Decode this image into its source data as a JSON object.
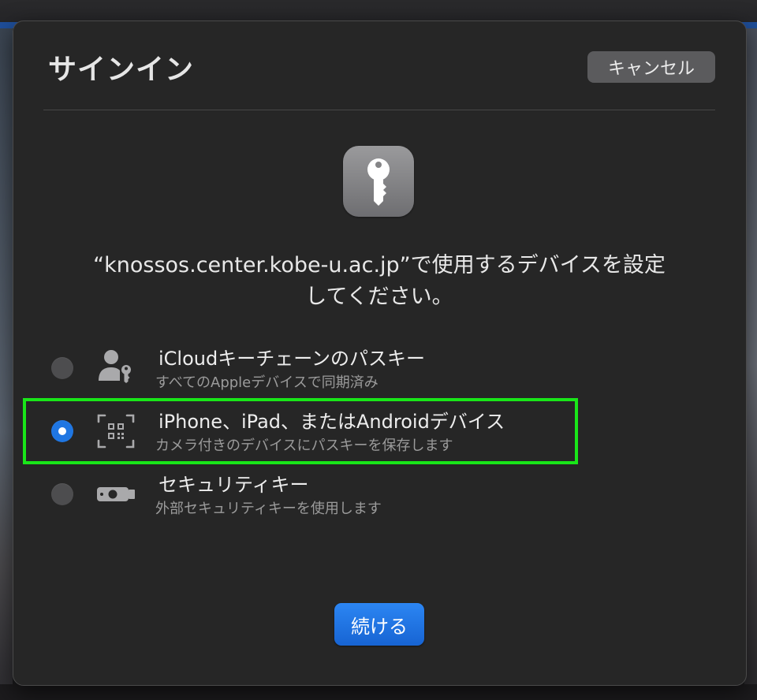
{
  "dialog": {
    "title": "サインイン",
    "cancel_label": "キャンセル",
    "message_line1": "“knossos.center.kobe-u.ac.jp”で使用するデバイスを設定",
    "message_line2": "してください。",
    "continue_label": "続ける",
    "app_icon": "key-icon"
  },
  "options": [
    {
      "title": "iCloudキーチェーンのパスキー",
      "subtitle": "すべてのAppleデバイスで同期済み",
      "icon": "person-key-icon",
      "selected": false
    },
    {
      "title": "iPhone、iPad、またはAndroidデバイス",
      "subtitle": "カメラ付きのデバイスにパスキーを保存します",
      "icon": "qr-code-scan-icon",
      "selected": true
    },
    {
      "title": "セキュリティキー",
      "subtitle": "外部セキュリティキーを使用します",
      "icon": "usb-security-key-icon",
      "selected": false
    }
  ],
  "colors": {
    "accent": "#1f76e2",
    "highlight": "#19e619",
    "sheet_background": "#262626"
  }
}
